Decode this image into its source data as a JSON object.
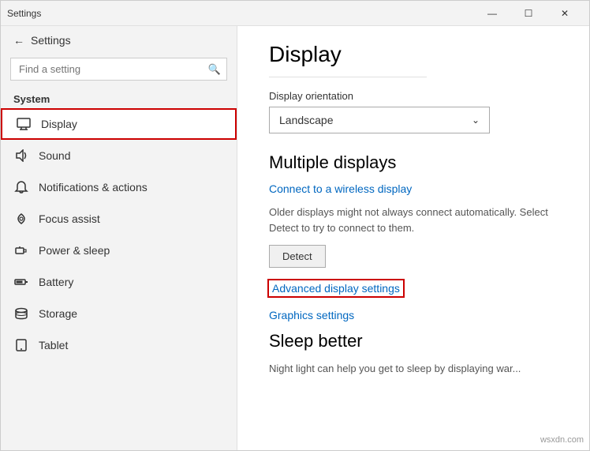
{
  "window": {
    "title": "Settings",
    "controls": {
      "minimize": "—",
      "maximize": "☐",
      "close": "✕"
    }
  },
  "sidebar": {
    "back_label": "Settings",
    "search_placeholder": "Find a setting",
    "section_label": "System",
    "items": [
      {
        "id": "display",
        "label": "Display",
        "active": true
      },
      {
        "id": "sound",
        "label": "Sound",
        "active": false
      },
      {
        "id": "notifications",
        "label": "Notifications & actions",
        "active": false
      },
      {
        "id": "focus",
        "label": "Focus assist",
        "active": false
      },
      {
        "id": "power",
        "label": "Power & sleep",
        "active": false
      },
      {
        "id": "battery",
        "label": "Battery",
        "active": false
      },
      {
        "id": "storage",
        "label": "Storage",
        "active": false
      },
      {
        "id": "tablet",
        "label": "Tablet",
        "active": false
      }
    ]
  },
  "main": {
    "title": "Display",
    "orientation_label": "Display orientation",
    "orientation_value": "Landscape",
    "multiple_displays_heading": "Multiple displays",
    "connect_wireless_link": "Connect to a wireless display",
    "description": "Older displays might not always connect automatically. Select Detect to try to connect to them.",
    "detect_button": "Detect",
    "advanced_link": "Advanced display settings",
    "graphics_link": "Graphics settings",
    "sleep_heading": "Sleep better",
    "sleep_description": "Night light can help you get to sleep by displaying war..."
  },
  "watermark": "wsxdn.com"
}
